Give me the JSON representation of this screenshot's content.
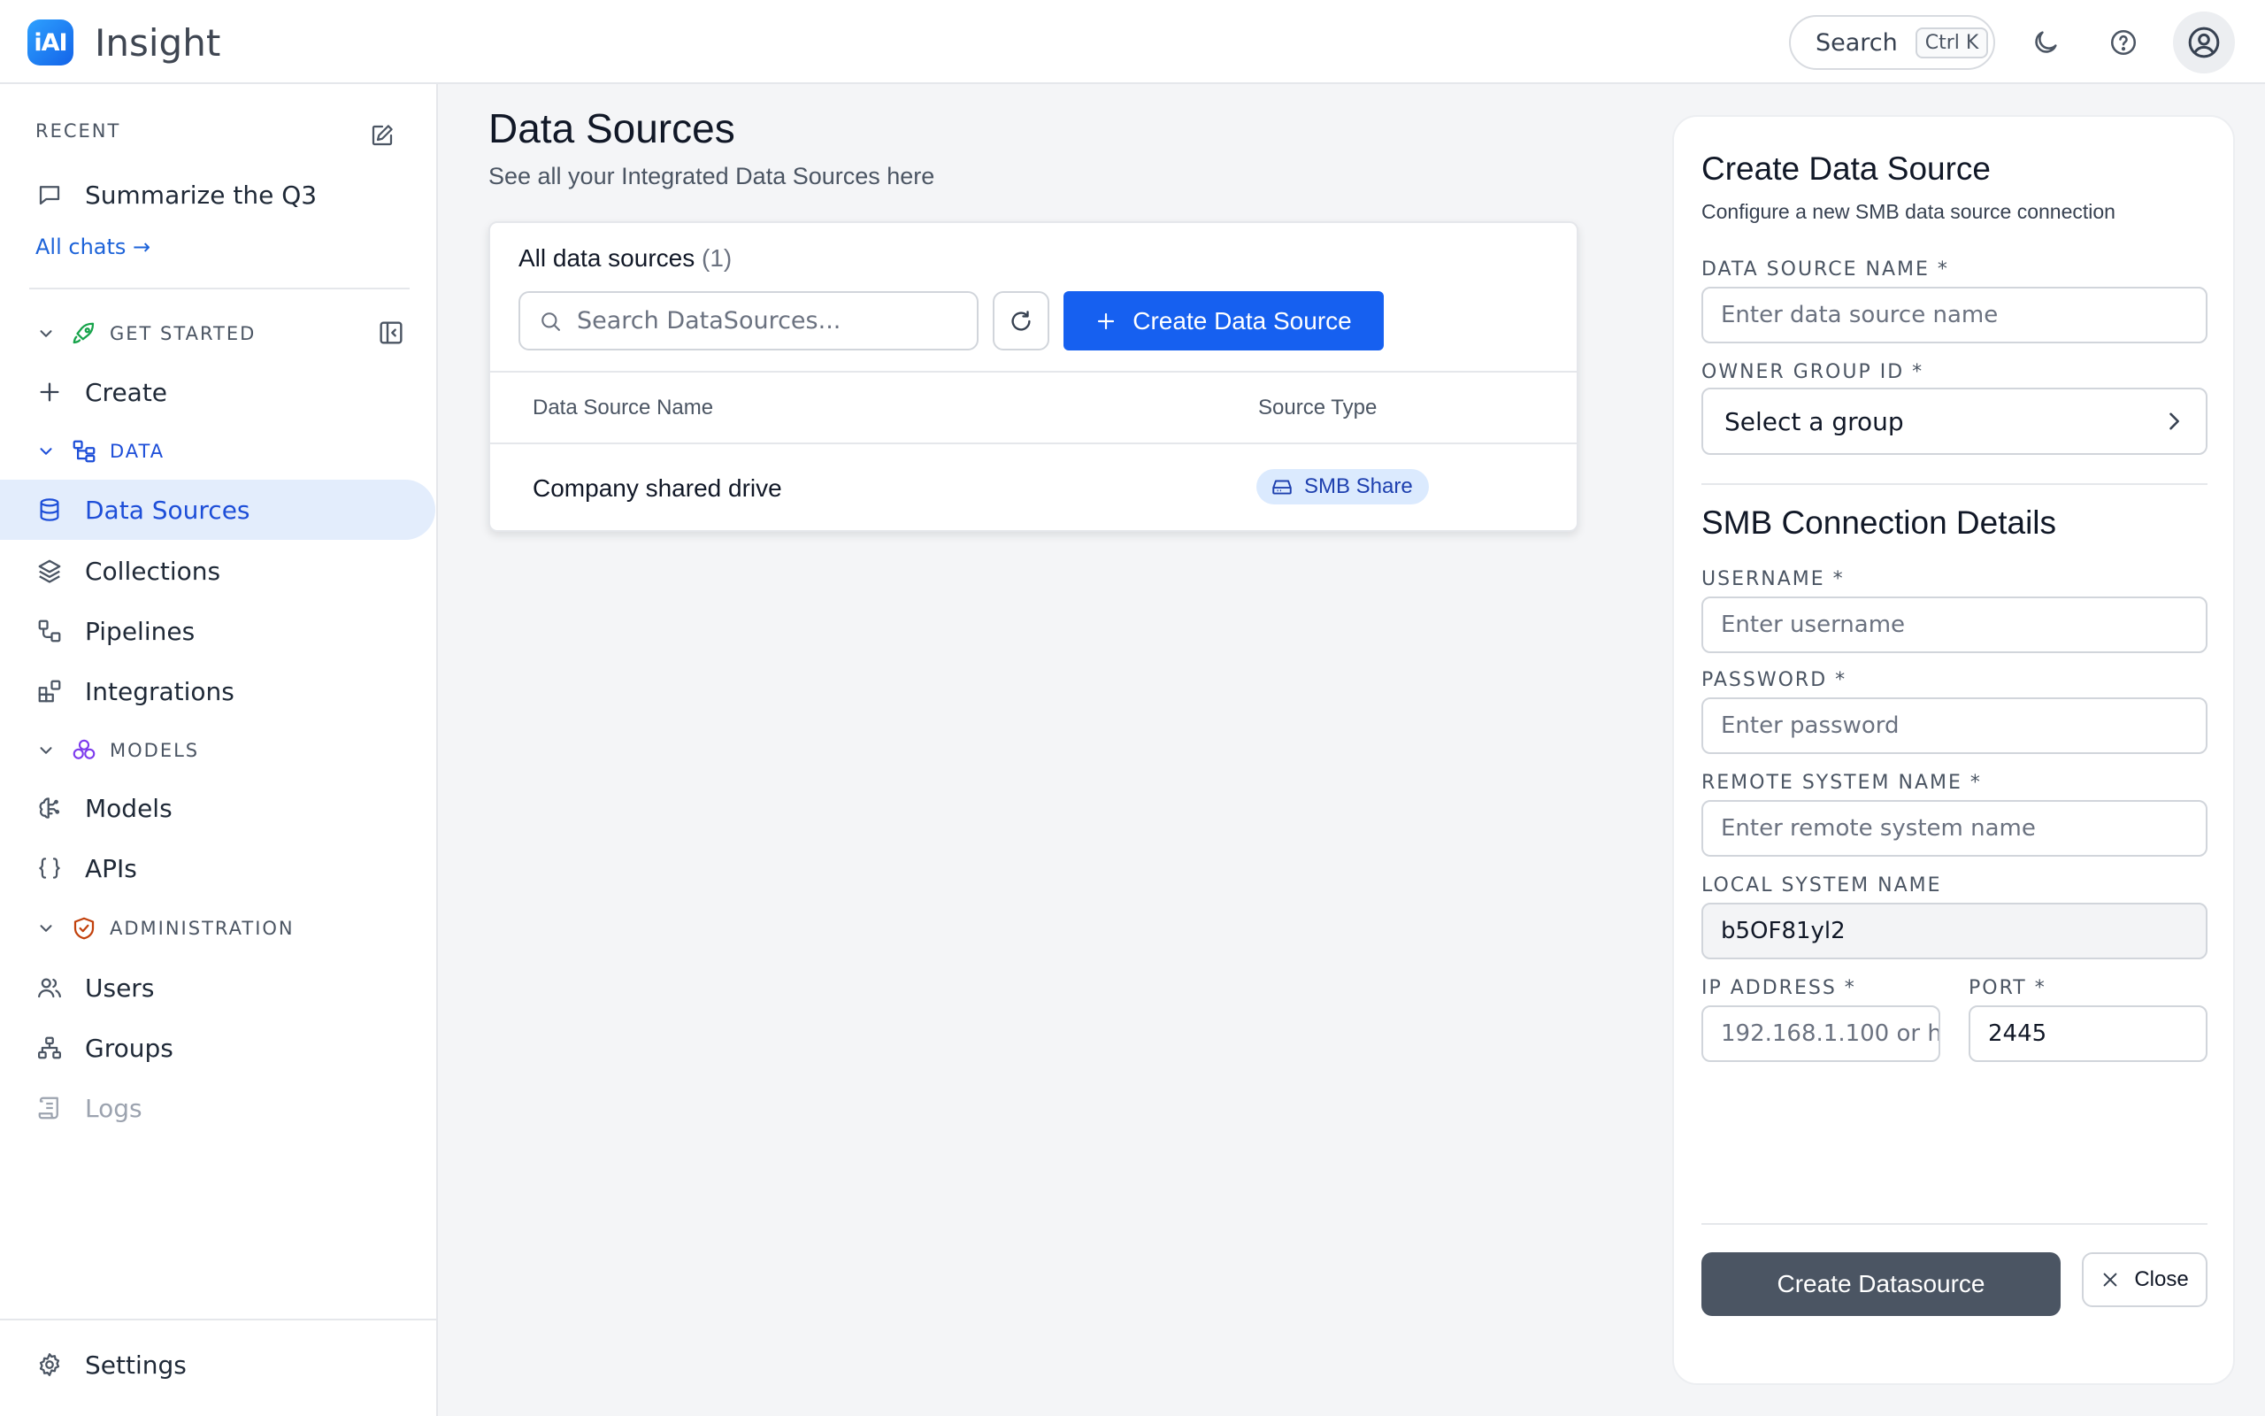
{
  "app": {
    "logo_text": "iAI",
    "title": "Insight"
  },
  "header": {
    "search_label": "Search",
    "search_shortcut": "Ctrl K"
  },
  "sidebar": {
    "recent_label": "RECENT",
    "recent_chat": "Summarize the Q3",
    "all_chats": "All chats →",
    "groups": {
      "get_started": "GET STARTED",
      "data": "DATA",
      "models": "MODELS",
      "administration": "ADMINISTRATION"
    },
    "items": {
      "create": "Create",
      "data_sources": "Data Sources",
      "collections": "Collections",
      "pipelines": "Pipelines",
      "integrations": "Integrations",
      "models": "Models",
      "apis": "APIs",
      "users": "Users",
      "groups": "Groups",
      "logs": "Logs",
      "settings": "Settings"
    }
  },
  "main": {
    "title": "Data Sources",
    "subtitle": "See all your Integrated Data Sources here",
    "card_title": "All data sources",
    "card_count": "(1)",
    "search_placeholder": "Search DataSources...",
    "create_button": "Create Data Source",
    "columns": [
      "Data Source Name",
      "Source Type"
    ],
    "rows": [
      {
        "name": "Company shared drive",
        "type": "SMB Share"
      }
    ]
  },
  "panel": {
    "title": "Create Data Source",
    "subtitle": "Configure a new SMB data source connection",
    "name_label": "DATA SOURCE NAME *",
    "name_placeholder": "Enter data source name",
    "owner_label": "OWNER GROUP ID *",
    "owner_value": "Select a group",
    "smb_title": "SMB Connection Details",
    "username_label": "USERNAME *",
    "username_placeholder": "Enter username",
    "password_label": "PASSWORD *",
    "password_placeholder": "Enter password",
    "remote_label": "REMOTE SYSTEM NAME *",
    "remote_placeholder": "Enter remote system name",
    "local_label": "LOCAL SYSTEM NAME",
    "local_value": "b5OF81yl2",
    "ip_label": "IP ADDRESS *",
    "ip_placeholder": "192.168.1.100 or h",
    "port_label": "PORT *",
    "port_value": "2445",
    "submit_button": "Create Datasource",
    "close_button": "Close"
  },
  "colors": {
    "accent": "#1660f0",
    "active_nav_bg": "#e3edfc",
    "badge_bg": "#dbeafe",
    "submit_bg": "#4b5563"
  }
}
